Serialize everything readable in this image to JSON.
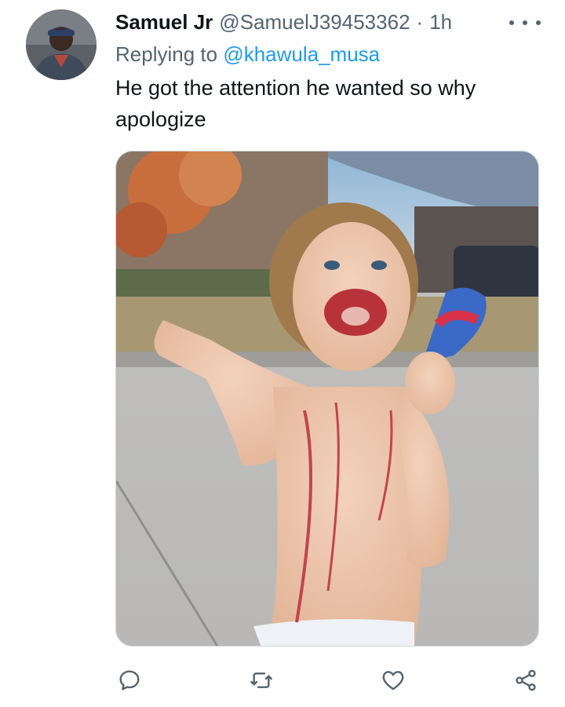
{
  "tweet": {
    "author": {
      "name": "Samuel Jr",
      "handle": "@SamuelJ39453362",
      "separator": "·",
      "time": "1h"
    },
    "reply_prefix": "Replying to",
    "reply_to": "@khawula_musa",
    "text": "He got the attention he wanted so why apologize"
  },
  "icons": {
    "more": "more-horizontal-icon",
    "reply": "reply-icon",
    "retweet": "retweet-icon",
    "like": "heart-icon",
    "share": "share-icon"
  },
  "colors": {
    "text": "#0f1419",
    "secondary": "#536471",
    "link": "#1d9bf0"
  }
}
